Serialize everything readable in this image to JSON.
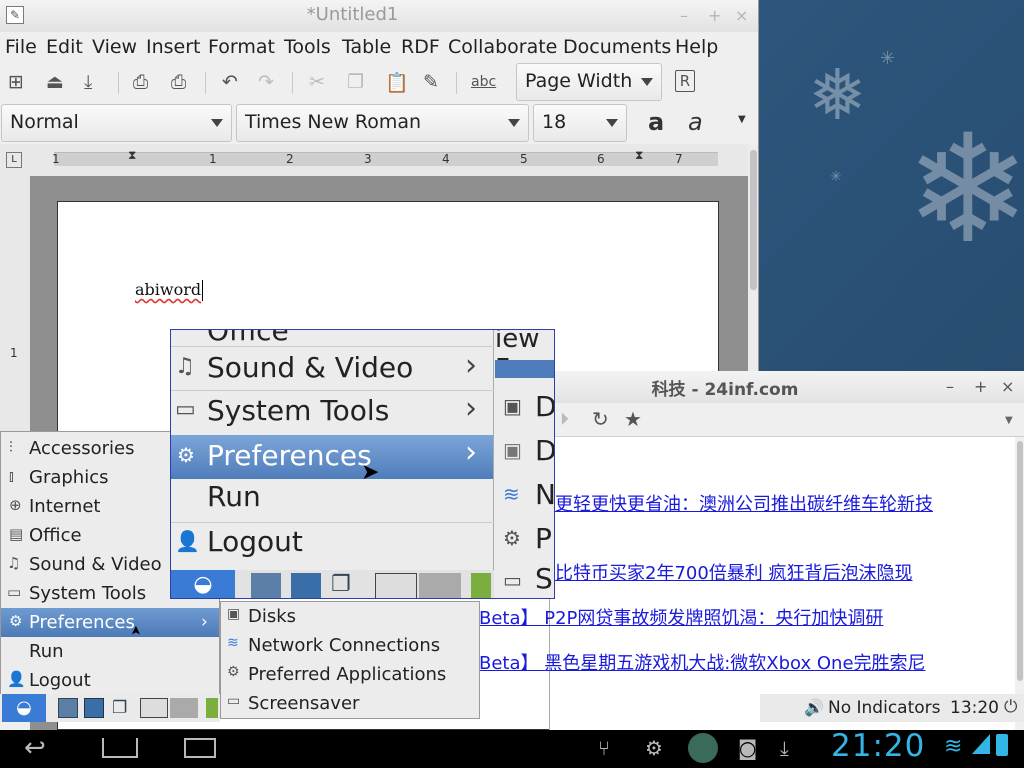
{
  "abiword": {
    "title": "*Untitled1",
    "window_controls": [
      "–",
      "+",
      "×"
    ],
    "menus": [
      "File",
      "Edit",
      "View",
      "Insert",
      "Format",
      "Tools",
      "Table",
      "RDF",
      "Collaborate",
      "Documents",
      "Help"
    ],
    "zoom_value": "Page Width",
    "style_value": "Normal",
    "font_value": "Times New Roman",
    "size_value": "18",
    "ruler_numbers": [
      "1",
      "1",
      "2",
      "3",
      "4",
      "5",
      "6",
      "7"
    ],
    "vruler_number": "1",
    "document_text": "abiword"
  },
  "browser": {
    "title": "科技 - 24inf.com",
    "window_controls": [
      "–",
      "+",
      "×"
    ],
    "news": [
      "更轻更快更省油：澳洲公司推出碳纤维车轮新技",
      "比特币买家2年700倍暴利 疯狂背后泡沫隐现",
      "Beta】 P2P网贷事故频发牌照饥渴：央行加快调研",
      "Beta】 黑色星期五游戏机大战:微软Xbox One完胜索尼"
    ]
  },
  "start_menu": {
    "items": [
      "Accessories",
      "Graphics",
      "Internet",
      "Office",
      "Sound & Video",
      "System Tools",
      "Preferences",
      "Run",
      "Logout"
    ],
    "selected": "Preferences"
  },
  "preferences_submenu": {
    "items": [
      "Disks",
      "Network Connections",
      "Preferred Applications",
      "Screensaver"
    ]
  },
  "zoom_overlay": {
    "partial_top": "Office",
    "items": [
      "Sound & Video",
      "System Tools",
      "Preferences",
      "Run",
      "Logout"
    ],
    "selected": "Preferences",
    "right_partial_top": "iew F",
    "right_letters": [
      "D",
      "D",
      "N",
      "P",
      "Sc"
    ]
  },
  "tray": {
    "indicators": "No Indicators",
    "time": "13:20"
  },
  "android": {
    "clock": "21:20"
  },
  "colors": {
    "selection": "#5a87c2",
    "link": "#1a1add",
    "android_clock": "#33b5e5"
  }
}
